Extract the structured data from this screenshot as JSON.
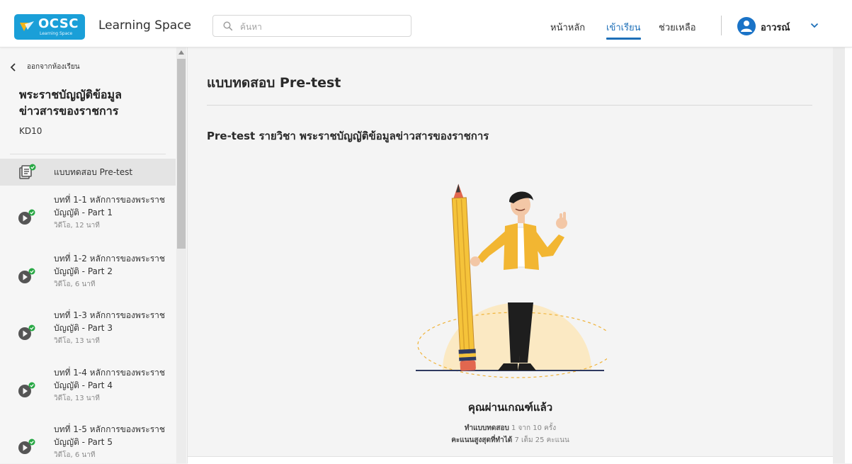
{
  "header": {
    "logo_text": "OCSC",
    "logo_sub": "Learning Space",
    "app_title": "Learning Space",
    "search_placeholder": "ค้นหา",
    "nav": {
      "home": "หน้าหลัก",
      "learn": "เข้าเรียน",
      "help": "ช่วยเหลือ"
    },
    "user_name": "อาวรณ์",
    "accent_color": "#1d6fb8"
  },
  "sidebar": {
    "back_label": "ออกจากห้องเรียน",
    "course_title": "พระราชบัญญัติข้อมูลข่าวสารของราชการ",
    "course_code": "KD10",
    "items": [
      {
        "title": "แบบทดสอบ Pre-test",
        "meta": "",
        "icon": "quiz-check-icon"
      },
      {
        "title": "บทที่ 1-1 หลักการของพระราชบัญญัติ - Part 1",
        "meta": "วิดีโอ, 12 นาที",
        "icon": "video-check-icon"
      },
      {
        "title": "บทที่ 1-2 หลักการของพระราชบัญญัติ - Part 2",
        "meta": "วิดีโอ, 6 นาที",
        "icon": "video-check-icon"
      },
      {
        "title": "บทที่ 1-3 หลักการของพระราชบัญญัติ - Part 3",
        "meta": "วิดีโอ, 13 นาที",
        "icon": "video-check-icon"
      },
      {
        "title": "บทที่ 1-4 หลักการของพระราชบัญญัติ - Part 4",
        "meta": "วิดีโอ, 13 นาที",
        "icon": "video-check-icon"
      },
      {
        "title": "บทที่ 1-5 หลักการของพระราชบัญญัติ - Part 5",
        "meta": "วิดีโอ, 6 นาที",
        "icon": "video-check-icon"
      }
    ]
  },
  "main": {
    "heading": "แบบทดสอบ Pre-test",
    "quiz_title": "Pre-test รายวิชา พระราชบัญญัติข้อมูลข่าวสารของราชการ",
    "result_title": "คุณผ่านเกณฑ์แล้ว",
    "attempts_label": "ทำแบบทดสอบ",
    "attempts_value": "1 จาก 10 ครั้ง",
    "score_label": "คะแนนสูงสุดที่ทำได้",
    "score_value": "7 เต็ม 25 คะแนน"
  }
}
